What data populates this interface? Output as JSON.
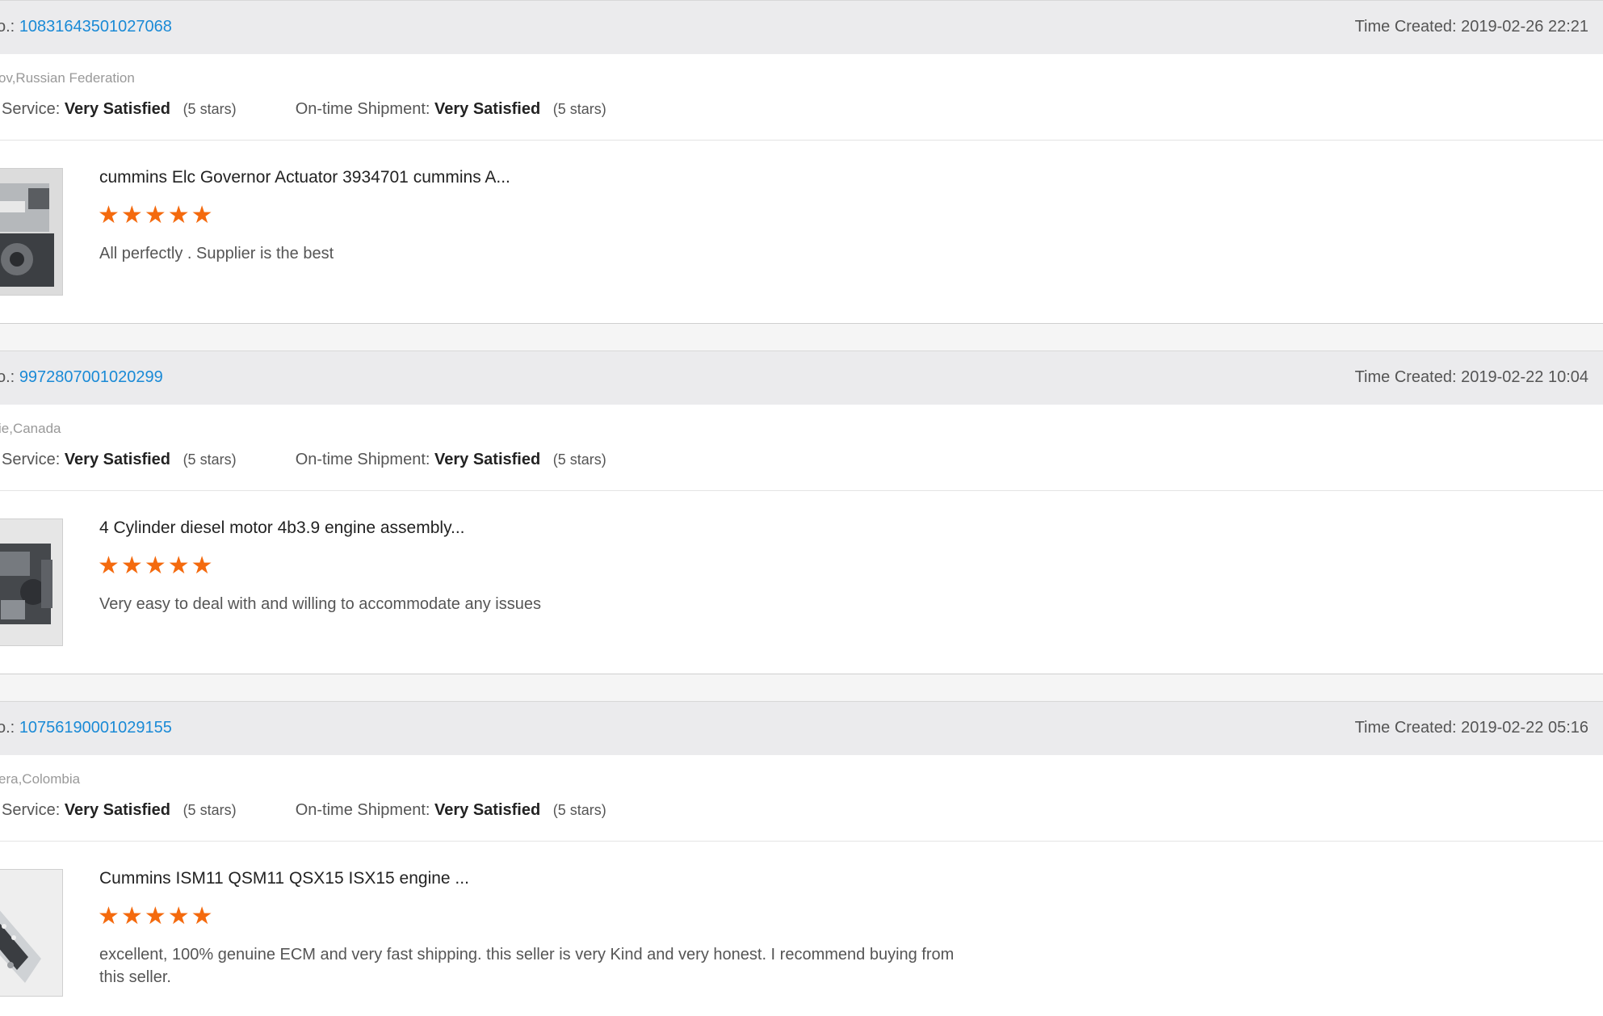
{
  "reviews": [
    {
      "order_label": "o.:",
      "order_no": "10831643501027068",
      "time": "Time Created: 2019-02-26 22:21",
      "location": "ov,Russian Federation",
      "service_label": "Service:",
      "service_value": "Very Satisfied",
      "service_stars": "(5 stars)",
      "shipment_label": "On-time Shipment:",
      "shipment_value": "Very Satisfied",
      "shipment_stars": "(5 stars)",
      "product": "cummins Elc Governor Actuator 3934701 cummins A...",
      "rating": 5,
      "comment": "All perfectly . Supplier is the best"
    },
    {
      "order_label": "o.:",
      "order_no": "9972807001020299",
      "time": "Time Created: 2019-02-22 10:04",
      "location": "ie,Canada",
      "service_label": "Service:",
      "service_value": "Very Satisfied",
      "service_stars": "(5 stars)",
      "shipment_label": "On-time Shipment:",
      "shipment_value": "Very Satisfied",
      "shipment_stars": "(5 stars)",
      "product": "4 Cylinder diesel motor 4b3.9 engine assembly...",
      "rating": 5,
      "comment": "Very easy to deal with and willing to accommodate any issues"
    },
    {
      "order_label": "o.:",
      "order_no": "10756190001029155",
      "time": "Time Created: 2019-02-22 05:16",
      "location": "era,Colombia",
      "service_label": "Service:",
      "service_value": "Very Satisfied",
      "service_stars": "(5 stars)",
      "shipment_label": "On-time Shipment:",
      "shipment_value": "Very Satisfied",
      "shipment_stars": "(5 stars)",
      "product": "Cummins ISM11 QSM11 QSX15 ISX15 engine ...",
      "rating": 5,
      "comment": "excellent, 100% genuine ECM and very fast shipping. this seller is very Kind and very honest. I recommend buying from this seller."
    }
  ],
  "colors": {
    "link": "#1a8ad6",
    "star": "#f46a0e",
    "bar": "#ebebed"
  },
  "icons": {
    "star": "star-icon"
  }
}
